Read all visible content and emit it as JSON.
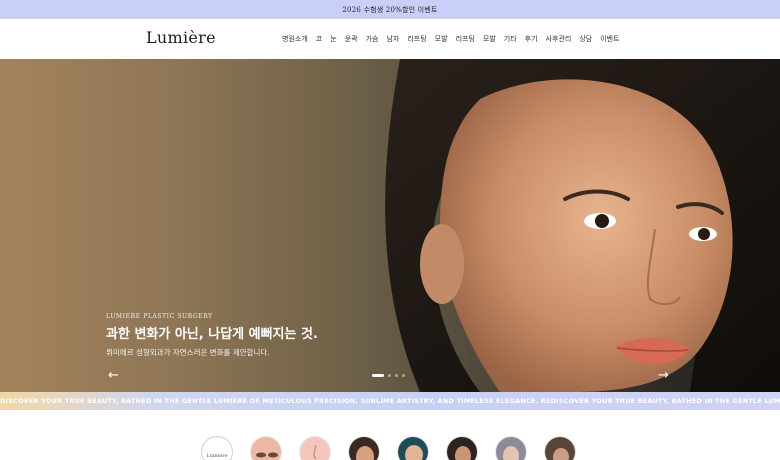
{
  "promo": {
    "text": "2026 수험생 20%할인 이벤트"
  },
  "header": {
    "logo": "Lumière",
    "nav": [
      "병원소개",
      "코",
      "눈",
      "윤곽",
      "가슴",
      "남자",
      "리프팅",
      "모발",
      "리프팅",
      "모발",
      "기타",
      "후기",
      "사후관리",
      "상담",
      "이벤트"
    ]
  },
  "hero": {
    "eyebrow": "LUMIERE PLASTIC SURGERY",
    "title": "과한 변화가 아닌, 나답게 예뻐지는 것.",
    "subtitle": "뤼미에르 성형외과가 자연스러운 변화를 제안합니다.",
    "prev_icon": "←",
    "next_icon": "→",
    "slide_count": 4,
    "active_slide": 1
  },
  "marquee": {
    "text": "DISCOVER YOUR TRUE BEAUTY, BATHED IN THE GENTLE LUMIÈRE OF METICULOUS PRECISION, SUBLIME ARTISTRY, AND TIMELESS ELEGANCE. REDISCOVER YOUR TRUE BEAUTY, BATHED IN THE GENTLE LUMIÈRE OF METICULOUS PRECISION, SUBLIME ARTISTRY, AND TIMELESS ELEGANCE."
  },
  "categories": {
    "logo_text": "Lumiere"
  },
  "colors": {
    "promo_bg": "#c9cff8",
    "marquee_bg": "#c7d0f4"
  }
}
